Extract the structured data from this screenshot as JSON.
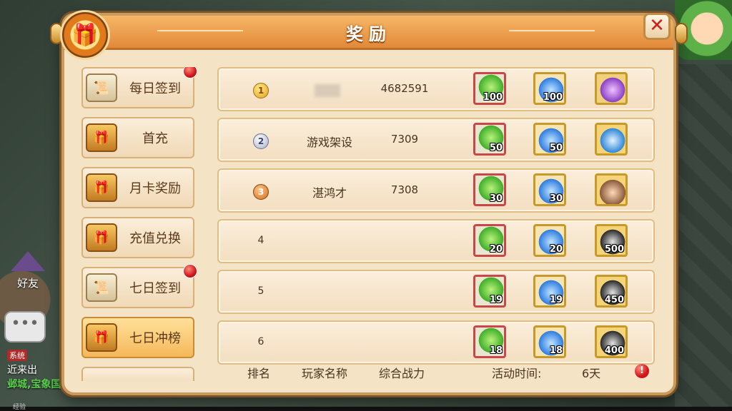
{
  "dialog": {
    "title": "奖励",
    "close_icon": "close-icon",
    "badge_icon": "gift-box-icon"
  },
  "sidebar": {
    "items": [
      {
        "label": "每日签到",
        "icon": "scroll-icon",
        "has_dot": true,
        "active": false
      },
      {
        "label": "首充",
        "icon": "treasure-chest-icon",
        "has_dot": false,
        "active": false
      },
      {
        "label": "月卡奖励",
        "icon": "treasure-chest-icon",
        "has_dot": false,
        "active": false
      },
      {
        "label": "充值兑换",
        "icon": "treasure-chest-icon",
        "has_dot": false,
        "active": false
      },
      {
        "label": "七日签到",
        "icon": "scroll-icon",
        "has_dot": true,
        "active": false
      },
      {
        "label": "七日冲榜",
        "icon": "treasure-chest-icon",
        "has_dot": false,
        "active": true
      }
    ]
  },
  "ranking": {
    "rows": [
      {
        "rank": "1",
        "name": "",
        "power": "4682591",
        "rewards": [
          "100",
          "100",
          ""
        ]
      },
      {
        "rank": "2",
        "name": "游戏架设",
        "power": "7309",
        "rewards": [
          "50",
          "50",
          ""
        ]
      },
      {
        "rank": "3",
        "name": "湛鸿才",
        "power": "7308",
        "rewards": [
          "30",
          "30",
          ""
        ]
      },
      {
        "rank": "4",
        "name": "",
        "power": "",
        "rewards": [
          "20",
          "20",
          "500"
        ]
      },
      {
        "rank": "5",
        "name": "",
        "power": "",
        "rewards": [
          "19",
          "19",
          "450"
        ]
      },
      {
        "rank": "6",
        "name": "",
        "power": "",
        "rewards": [
          "18",
          "18",
          "400"
        ]
      }
    ]
  },
  "footer": {
    "rank_label": "排名",
    "name_label": "玩家名称",
    "power_label": "综合战力",
    "time_label": "活动时间:",
    "time_value": "6天",
    "warn_icon": "!"
  },
  "hud": {
    "friend_label": "好友",
    "chat_icon": "•••",
    "chat_tag": "系统",
    "chat_line": "近来出",
    "chat_location": "邺城,宝象国",
    "exp_label": "经验"
  }
}
